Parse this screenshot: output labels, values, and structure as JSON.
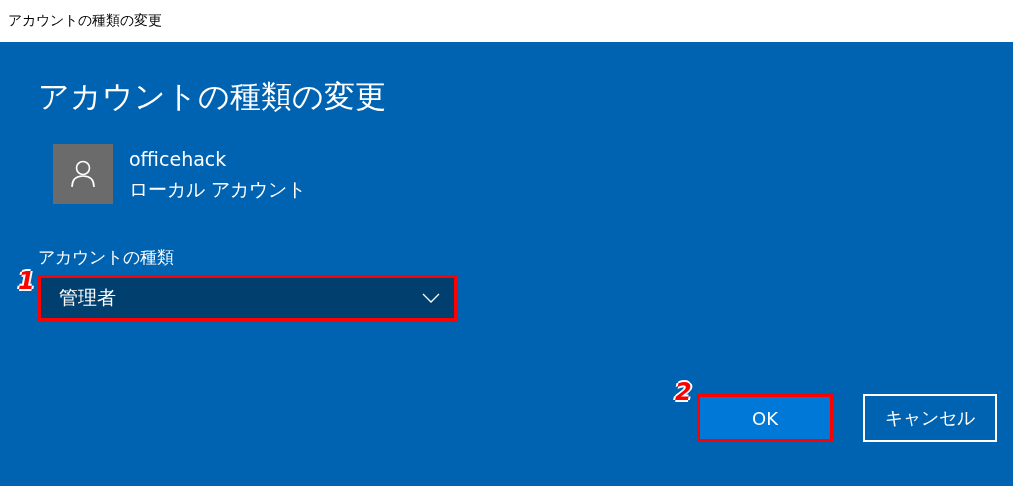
{
  "window": {
    "title": "アカウントの種類の変更"
  },
  "heading": "アカウントの種類の変更",
  "account": {
    "name": "officehack",
    "type": "ローカル アカウント"
  },
  "account_type": {
    "label": "アカウントの種類",
    "value": "管理者",
    "highlighted": true,
    "step": "1"
  },
  "buttons": [
    {
      "label": "OK",
      "kind": "primary",
      "highlighted": true,
      "step": "2"
    },
    {
      "label": "キャンセル",
      "kind": "secondary",
      "highlighted": false
    }
  ]
}
